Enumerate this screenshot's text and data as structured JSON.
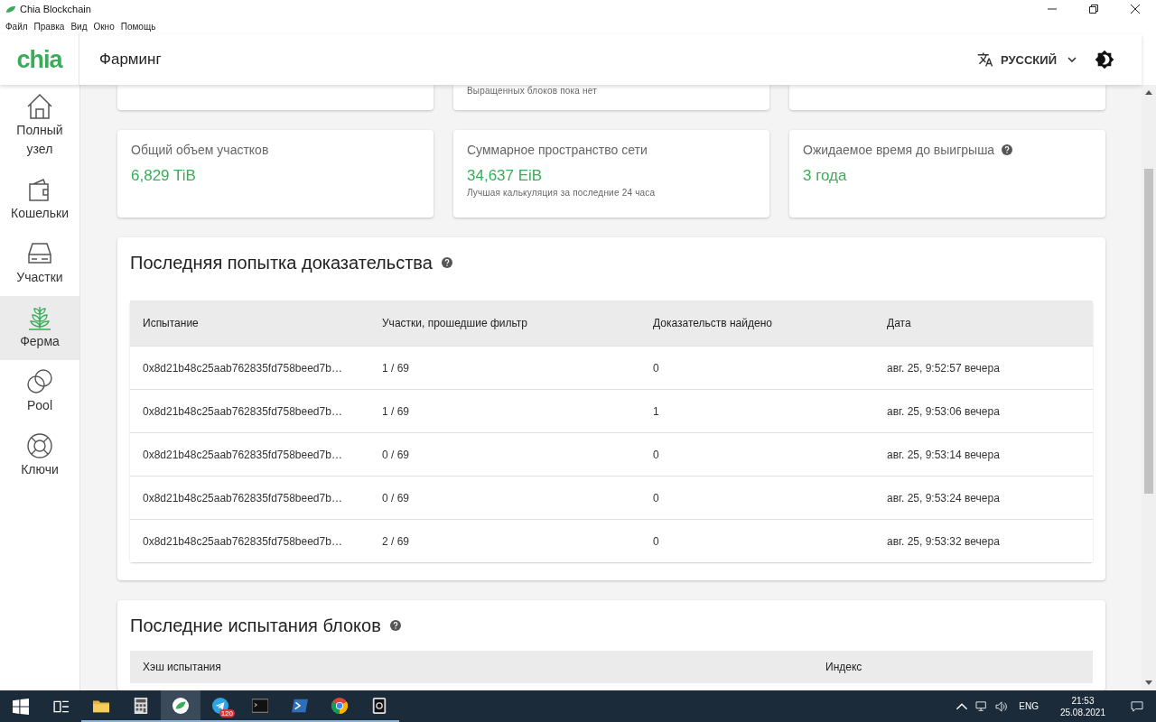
{
  "window": {
    "title": "Chia Blockchain",
    "menu": [
      "Файл",
      "Правка",
      "Вид",
      "Окно",
      "Помощь"
    ]
  },
  "header": {
    "logo": "chia",
    "title": "Фарминг",
    "language": "РУССКИЙ"
  },
  "sidebar": {
    "items": [
      {
        "label": "Полный узел",
        "kind": "home",
        "selected": false
      },
      {
        "label": "Кошельки",
        "kind": "wallet",
        "selected": false
      },
      {
        "label": "Участки",
        "kind": "drive",
        "selected": false
      },
      {
        "label": "Ферма",
        "kind": "plant",
        "selected": true
      },
      {
        "label": "Pool",
        "kind": "rings",
        "selected": false
      },
      {
        "label": "Ключи",
        "kind": "lifebuoy",
        "selected": false
      }
    ]
  },
  "partial_cards": [
    {
      "kind": "blank"
    },
    {
      "kind": "note",
      "note": "Выращенных блоков пока нет"
    },
    {
      "kind": "blank"
    }
  ],
  "stat_cards": [
    {
      "title": "Общий объем участков",
      "value": "6,829 TiB"
    },
    {
      "title": "Суммарное пространство сети",
      "value": "34,637 EiB",
      "note": "Лучшая калькуляция за последние 24 часа"
    },
    {
      "title": "Ожидаемое время до выигрыша",
      "value": "3 года",
      "help": true
    }
  ],
  "proofs": {
    "title": "Последняя попытка доказательства",
    "help": true,
    "columns": [
      "Испытание",
      "Участки, прошедшие фильтр",
      "Доказательств найдено",
      "Дата"
    ],
    "rows": [
      [
        "0x8d21b48c25aab762835fd758beed7b…",
        "1 / 69",
        "0",
        "авг. 25, 9:52:57 вечера"
      ],
      [
        "0x8d21b48c25aab762835fd758beed7b…",
        "1 / 69",
        "1",
        "авг. 25, 9:53:06 вечера"
      ],
      [
        "0x8d21b48c25aab762835fd758beed7b…",
        "0 / 69",
        "0",
        "авг. 25, 9:53:14 вечера"
      ],
      [
        "0x8d21b48c25aab762835fd758beed7b…",
        "0 / 69",
        "0",
        "авг. 25, 9:53:24 вечера"
      ],
      [
        "0x8d21b48c25aab762835fd758beed7b…",
        "2 / 69",
        "0",
        "авг. 25, 9:53:32 вечера"
      ]
    ]
  },
  "blocks": {
    "title": "Последние испытания блоков",
    "help": true,
    "columns": [
      "Хэш испытания",
      "Индекс"
    ]
  },
  "taskbar": {
    "apps": [
      {
        "kind": "tasks",
        "active": false
      },
      {
        "kind": "folder",
        "active": true
      },
      {
        "kind": "calculator",
        "active": true
      },
      {
        "kind": "leaf",
        "active": true,
        "selected": true
      },
      {
        "kind": "telegram",
        "active": true,
        "badge": "120"
      },
      {
        "kind": "terminal",
        "active": true
      },
      {
        "kind": "powershell",
        "active": true
      },
      {
        "kind": "chrome",
        "active": true
      },
      {
        "kind": "qapp",
        "active": true
      }
    ],
    "language": "ENG",
    "time": "21:53",
    "date": "25.08.2021"
  }
}
